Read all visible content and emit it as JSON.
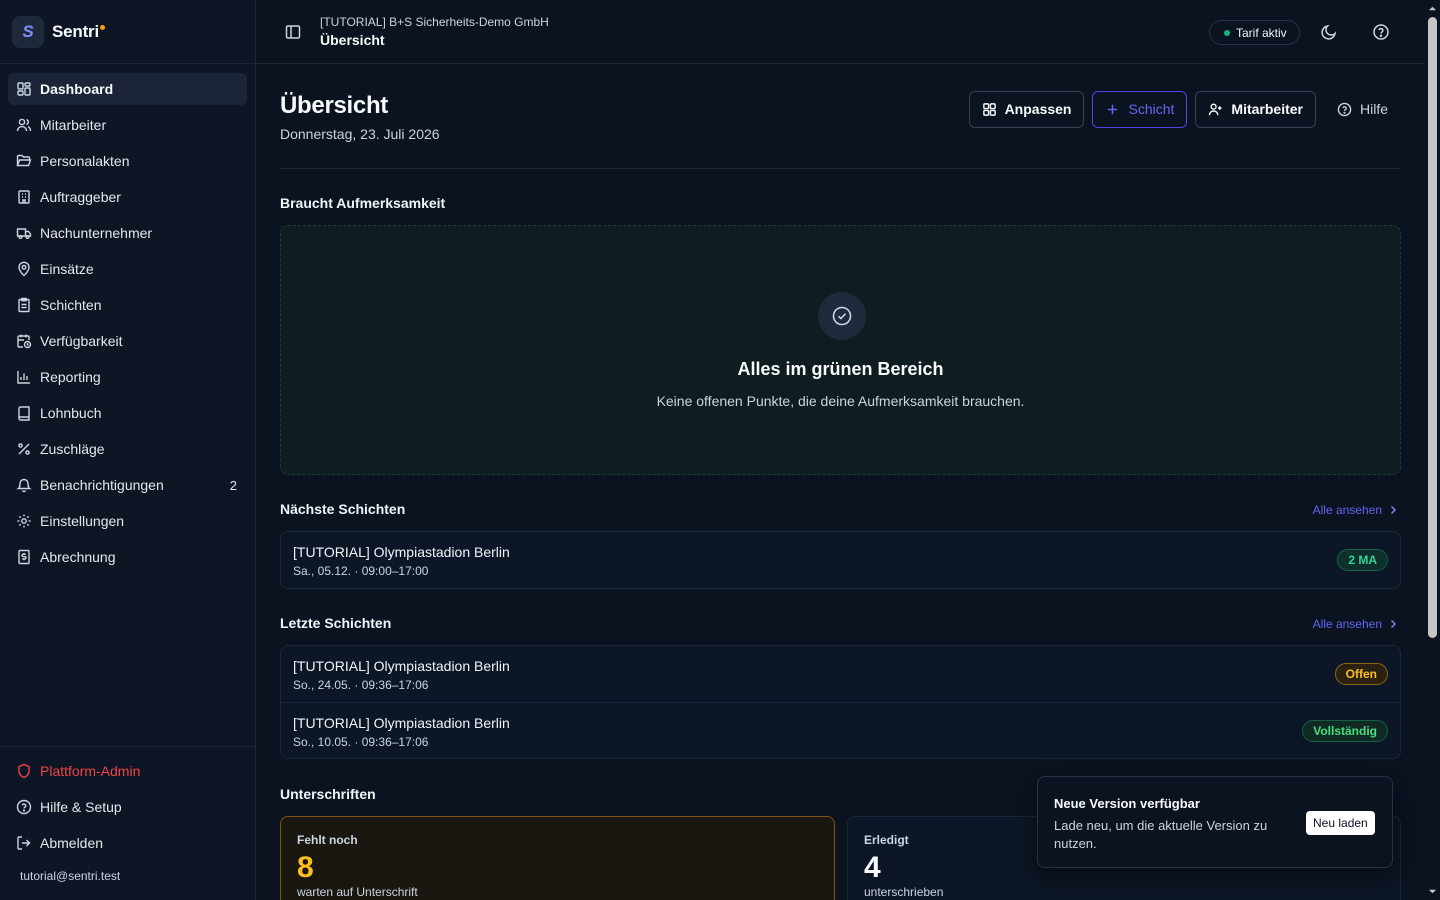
{
  "brand": {
    "logo_letter": "S",
    "name": "Sentri",
    "accent_color": "#818cf8"
  },
  "sidebar": {
    "items": [
      {
        "label": "Dashboard",
        "icon": "dashboard-icon",
        "active": true
      },
      {
        "label": "Mitarbeiter",
        "icon": "users-icon"
      },
      {
        "label": "Personalakten",
        "icon": "folder-open-icon"
      },
      {
        "label": "Auftraggeber",
        "icon": "building-icon"
      },
      {
        "label": "Nachunternehmer",
        "icon": "truck-icon"
      },
      {
        "label": "Einsätze",
        "icon": "map-pin-icon"
      },
      {
        "label": "Schichten",
        "icon": "clipboard-icon"
      },
      {
        "label": "Verfügbarkeit",
        "icon": "calendar-clock-icon"
      },
      {
        "label": "Reporting",
        "icon": "bar-chart-icon"
      },
      {
        "label": "Lohnbuch",
        "icon": "book-icon"
      },
      {
        "label": "Zuschläge",
        "icon": "percent-icon"
      },
      {
        "label": "Benachrichtigungen",
        "icon": "bell-icon",
        "count": "2"
      },
      {
        "label": "Einstellungen",
        "icon": "gear-icon"
      },
      {
        "label": "Abrechnung",
        "icon": "receipt-icon"
      }
    ],
    "bottom_items": [
      {
        "label": "Plattform-Admin",
        "icon": "shield-icon",
        "color": "#ef4444"
      },
      {
        "label": "Hilfe & Setup",
        "icon": "help-circle-icon"
      },
      {
        "label": "Abmelden",
        "icon": "log-out-icon"
      }
    ],
    "user_email": "tutorial@sentri.test"
  },
  "topbar": {
    "org": "[TUTORIAL] B+S Sicherheits-Demo GmbH",
    "page": "Übersicht",
    "tarif": "Tarif aktiv",
    "tarif_color": "#10b981"
  },
  "header": {
    "title": "Übersicht",
    "date": "Donnerstag, 23. Juli 2026",
    "actions": {
      "customize": "Anpassen",
      "shift": "Schicht",
      "employee": "Mitarbeiter",
      "help": "Hilfe"
    }
  },
  "attention": {
    "section_title": "Braucht Aufmerksamkeit",
    "title": "Alles im grünen Bereich",
    "subtitle": "Keine offenen Punkte, die deine Aufmerksamkeit brauchen."
  },
  "next_shifts": {
    "section_title": "Nächste Schichten",
    "see_all": "Alle ansehen",
    "rows": [
      {
        "title": "[TUTORIAL] Olympiastadion Berlin",
        "sub": "Sa., 05.12. · 09:00–17:00",
        "badge": "2 MA",
        "badge_style": "teal"
      }
    ]
  },
  "last_shifts": {
    "section_title": "Letzte Schichten",
    "see_all": "Alle ansehen",
    "rows": [
      {
        "title": "[TUTORIAL] Olympiastadion Berlin",
        "sub": "So., 24.05. · 09:36–17:06",
        "badge": "Offen",
        "badge_style": "amber"
      },
      {
        "title": "[TUTORIAL] Olympiastadion Berlin",
        "sub": "So., 10.05. · 09:36–17:06",
        "badge": "Vollständig",
        "badge_style": "green"
      }
    ]
  },
  "signatures": {
    "section_title": "Unterschriften",
    "missing": {
      "label": "Fehlt noch",
      "value": "8",
      "sub": "warten auf Unterschrift"
    },
    "done": {
      "label": "Erledigt",
      "value": "4",
      "sub": "unterschrieben"
    }
  },
  "toast": {
    "title": "Neue Version verfügbar",
    "body": "Lade neu, um die aktuelle Version zu nutzen.",
    "button": "Neu laden"
  }
}
